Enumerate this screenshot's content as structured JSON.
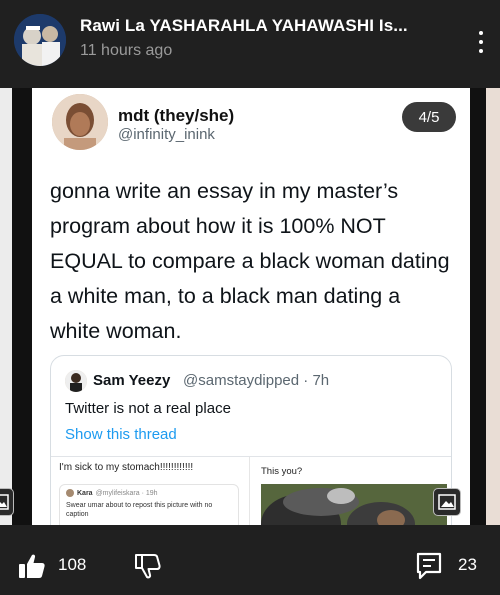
{
  "post": {
    "title": "Rawi La YASHARAHLA YAHAWASHI Is...",
    "time": "11 hours ago"
  },
  "tweet": {
    "name": "mdt (they/she)",
    "handle": "@infinity_inink",
    "counter": "4/5",
    "text": "gonna write an essay in my master’s program about how it is 100% NOT EQUAL to compare a black woman dating a white man, to a black man dating a white woman."
  },
  "quote": {
    "name": "Sam Yeezy",
    "handle": "@samstaydipped · 7h",
    "text": "Twitter is not a real place",
    "link": "Show this thread",
    "left_text": "I'm sick to my stomach!!!!!!!!!!!!",
    "right_text": "This you?",
    "mini": {
      "name": "Kara",
      "handle": "@mylifeiskara · 19h",
      "text": "Swear umar about to repost this picture with no caption"
    }
  },
  "footer": {
    "likes": "108",
    "comments": "23"
  },
  "colors": {
    "background": "#202020",
    "link": "#1d9bf0",
    "muted": "#9a9a9a"
  },
  "icons": [
    "more-vertical-icon",
    "thumbs-up-icon",
    "thumbs-down-icon",
    "comment-icon",
    "gallery-icon"
  ]
}
